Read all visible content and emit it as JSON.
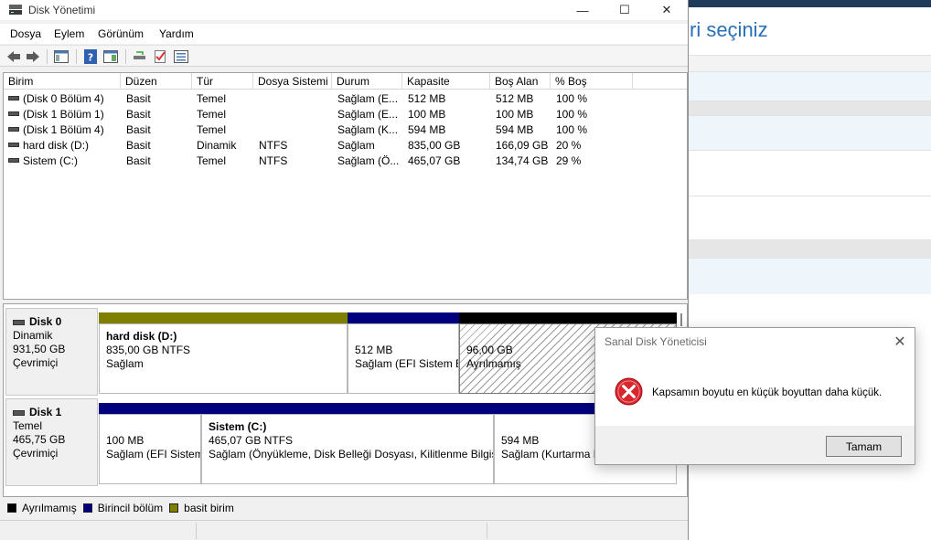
{
  "window": {
    "title": "Disk Yönetimi"
  },
  "background": {
    "title": "ri seçiniz"
  },
  "menu": [
    "Dosya",
    "Eylem",
    "Görünüm",
    "Yardım"
  ],
  "list": {
    "columns": [
      "Birim",
      "Düzen",
      "Tür",
      "Dosya Sistemi",
      "Durum",
      "Kapasite",
      "Boş Alan",
      "% Boş"
    ],
    "rows": [
      [
        "(Disk 0 Bölüm 4)",
        "Basit",
        "Temel",
        "",
        "Sağlam (E...",
        "512 MB",
        "512 MB",
        "100 %"
      ],
      [
        "(Disk 1 Bölüm 1)",
        "Basit",
        "Temel",
        "",
        "Sağlam (E...",
        "100 MB",
        "100 MB",
        "100 %"
      ],
      [
        "(Disk 1 Bölüm 4)",
        "Basit",
        "Temel",
        "",
        "Sağlam (K...",
        "594 MB",
        "594 MB",
        "100 %"
      ],
      [
        "hard disk (D:)",
        "Basit",
        "Dinamik",
        "NTFS",
        "Sağlam",
        "835,00 GB",
        "166,09 GB",
        "20 %"
      ],
      [
        "Sistem (C:)",
        "Basit",
        "Temel",
        "NTFS",
        "Sağlam (Ö...",
        "465,07 GB",
        "134,74 GB",
        "29 %"
      ]
    ]
  },
  "disks": [
    {
      "name": "Disk 0",
      "type": "Dinamik",
      "size": "931,50 GB",
      "status": "Çevrimiçi",
      "partitions": [
        {
          "name": "hard disk  (D:)",
          "line1": "835,00 GB NTFS",
          "line2": "Sağlam",
          "color": "#808000"
        },
        {
          "name": "",
          "line1": "512 MB",
          "line2": "Sağlam (EFI Sistem B",
          "color": "#00007f"
        },
        {
          "name": "",
          "line1": "96,00 GB",
          "line2": "Ayrılmamış",
          "color": "#000000"
        }
      ]
    },
    {
      "name": "Disk 1",
      "type": "Temel",
      "size": "465,75 GB",
      "status": "Çevrimiçi",
      "partitions": [
        {
          "name": "",
          "line1": "100 MB",
          "line2": "Sağlam (EFI Sistem",
          "color": "#00007f"
        },
        {
          "name": "Sistem  (C:)",
          "line1": "465,07 GB NTFS",
          "line2": "Sağlam (Önyükleme, Disk Belleği Dosyası, Kilitlenme Bilgis",
          "color": "#00007f"
        },
        {
          "name": "",
          "line1": "594 MB",
          "line2": "Sağlam (Kurtarma B",
          "color": "#00007f"
        }
      ]
    }
  ],
  "legend": [
    {
      "label": "Ayrılmamış",
      "color": "#000000"
    },
    {
      "label": "Birincil bölüm",
      "color": "#00007f"
    },
    {
      "label": "basit birim",
      "color": "#808000"
    }
  ],
  "dialog": {
    "title": "Sanal Disk Yöneticisi",
    "message": "Kapsamın boyutu en küçük boyuttan daha küçük.",
    "ok_label": "Tamam",
    "icon": "error-icon"
  }
}
